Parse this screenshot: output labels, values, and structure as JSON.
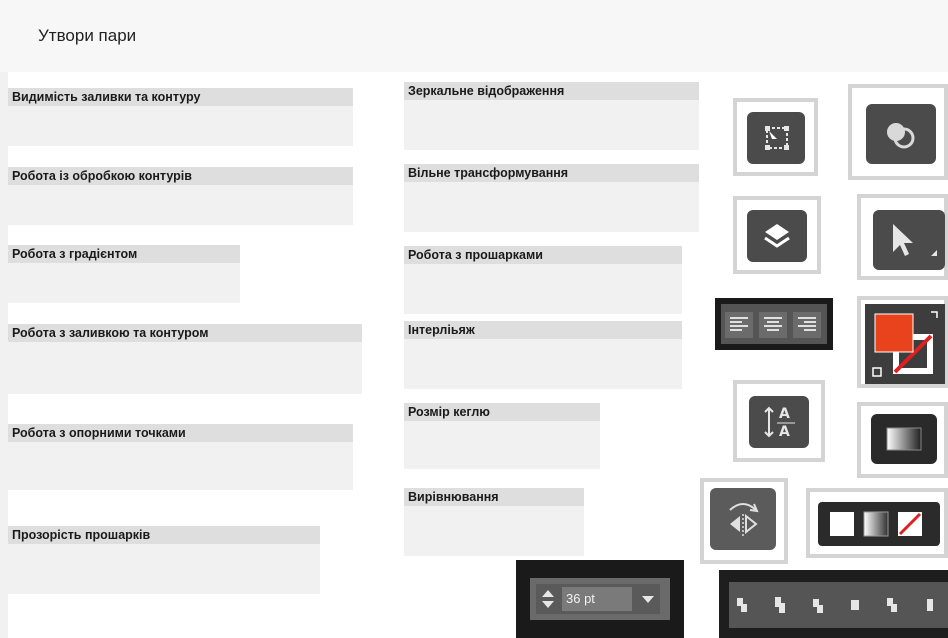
{
  "title": "Утвори пари",
  "left_cards": [
    "Видимість заливки та контуру",
    "Робота із обробкою контурів",
    "Робота з градієнтом",
    "Робота з заливкою та контуром",
    "Робота з опорними точками",
    "Прозорість прошарків"
  ],
  "mid_cards": [
    "Зеркальне відображення",
    "Вільне трансформування",
    "Робота з прошарками",
    "Інтерліьяж",
    "Розмір кеглю",
    "Вирівнювання"
  ],
  "font_size": {
    "value": "36 pt"
  },
  "icons": {
    "free_transform": "free-transform-icon",
    "shape_builder": "shape-builder-icon",
    "layers": "layers-icon",
    "direct_select": "direct-selection-icon",
    "align_buttons": "text-align-icon",
    "fill_stroke": "fill-stroke-icon",
    "leading": "leading-icon",
    "gradient": "gradient-icon",
    "reflect": "reflect-icon",
    "color_none": "color-gradient-none-icon",
    "distribute": "distribute-icon"
  },
  "colors": {
    "fill_swatch": "#e8431c",
    "tile_border": "#d4d4d4",
    "tile_dark": "#4b4b4b"
  }
}
